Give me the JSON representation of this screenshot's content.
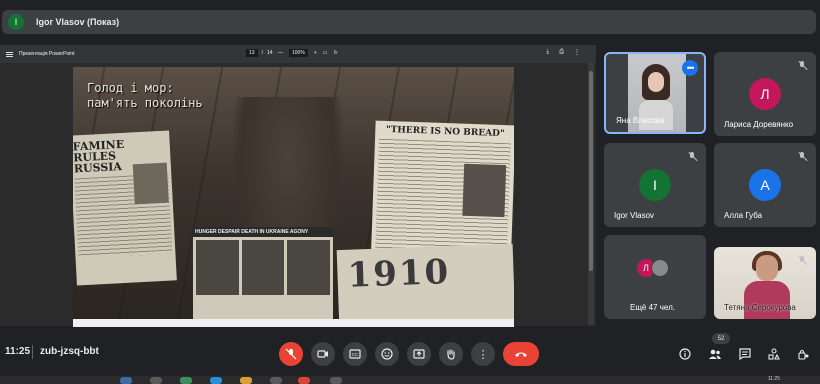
{
  "presenter": {
    "avatar_letter": "I",
    "name": "Igor Vlasov (Показ)"
  },
  "pdf_toolbar": {
    "title": "Презентація PowerPoint",
    "page_current": "13",
    "page_sep": "/",
    "page_total": "14",
    "zoom_out": "—",
    "zoom": "100%",
    "zoom_in": "+"
  },
  "slide": {
    "title_line1": "Голод і мор:",
    "title_line2": "пам'ять поколінь",
    "clip_left_head": "FAMINE RULES RUSSIA",
    "clip_right_head": "\"THERE IS NO BREAD\"",
    "clip_center_head": "HUNGER DESPAIR DEATH IN UKRAINE AGONY",
    "clip_br_big": "1910"
  },
  "participants": [
    {
      "name": "Яна Власова",
      "type": "video"
    },
    {
      "name": "Лариса Доревянко",
      "avatar_letter": "Л",
      "color": "#c2185b"
    },
    {
      "name": "Igor Vlasov",
      "avatar_letter": "I",
      "color": "#137333"
    },
    {
      "name": "Алла Губа",
      "avatar_letter": "А",
      "color": "#1a73e8"
    },
    {
      "name": "Ещё 47 чел.",
      "avatar_letter": "Л",
      "color": "#c2185b"
    },
    {
      "name": "Тетяна Серокурова",
      "type": "video"
    }
  ],
  "bottom_bar": {
    "time": "11:25",
    "meeting_code": "zub-jzsq-bbt",
    "people_count": "52",
    "buttons": [
      "mic-off",
      "camera",
      "captions",
      "emoji",
      "present",
      "raise-hand",
      "more",
      "end-call"
    ],
    "right_buttons": [
      "info",
      "people",
      "chat",
      "activities",
      "host-controls"
    ]
  },
  "taskbar": {
    "time": "11:25"
  }
}
